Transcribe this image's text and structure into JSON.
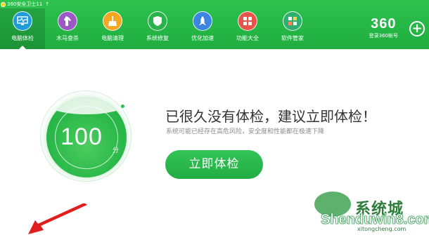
{
  "titlebar": {
    "title": "360安全卫士11",
    "arrow": "↑"
  },
  "nav": [
    {
      "label": "电脑体检",
      "icon": "monitor-pulse-icon",
      "color": "#1e9bd9",
      "active": true
    },
    {
      "label": "木马查杀",
      "icon": "horse-icon",
      "color": "#9b59c6",
      "active": false
    },
    {
      "label": "电脑清理",
      "icon": "broom-icon",
      "color": "#f5a623",
      "active": false
    },
    {
      "label": "系统修复",
      "icon": "shield-icon",
      "color": "#2bb24c",
      "active": false
    },
    {
      "label": "优化加速",
      "icon": "rocket-icon",
      "color": "#3a86e0",
      "active": false
    },
    {
      "label": "功能大全",
      "icon": "grid-icon",
      "color": "#e8534a",
      "active": false
    },
    {
      "label": "软件管家",
      "icon": "apps-icon",
      "color": "#2fb070",
      "active": false
    }
  ],
  "brand": {
    "number": "360",
    "login": "登录360帐号",
    "plus": "+"
  },
  "score": {
    "value": "100",
    "unit": "分"
  },
  "main": {
    "headline": "已很久没有体检，建议立即体检！",
    "subline": "系统可能已经存在高危风险，安全度和性能都在极速下降",
    "button": "立即体检"
  },
  "watermark": {
    "cn": "系统城",
    "main": "Shenduwin8.com",
    "sub": "xitongcheng.com"
  }
}
